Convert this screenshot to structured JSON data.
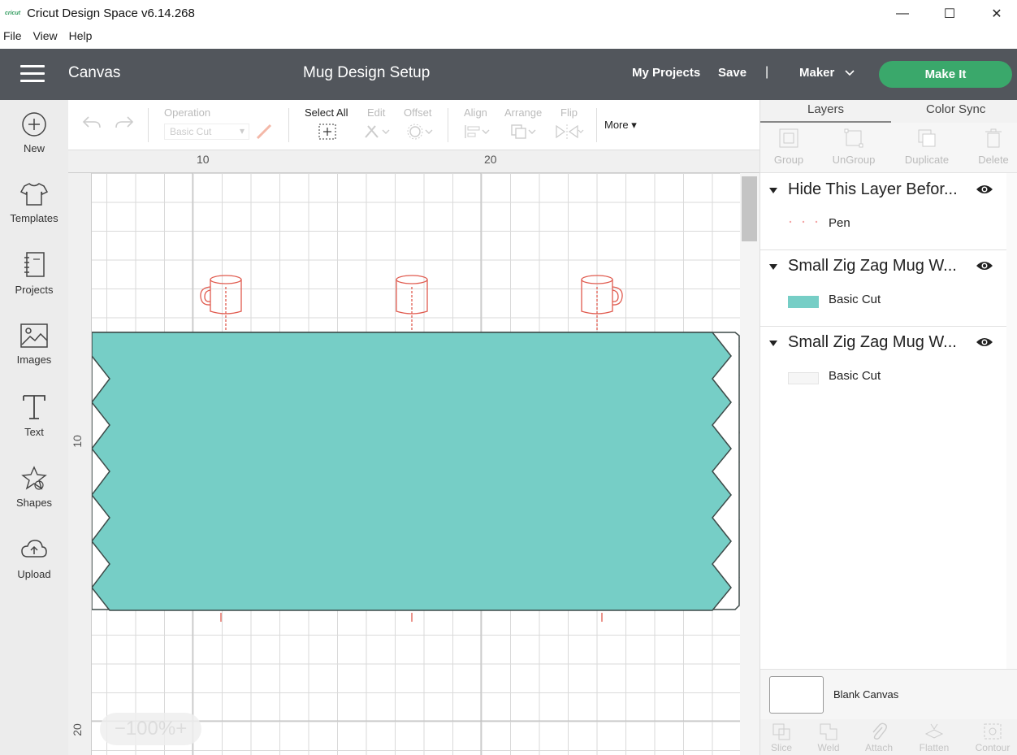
{
  "window": {
    "logo_text": "cricut",
    "title": "Cricut Design Space  v6.14.268",
    "minimize_glyph": "—",
    "maximize_glyph": "☐",
    "close_glyph": "✕"
  },
  "menu": [
    "File",
    "View",
    "Help"
  ],
  "header": {
    "section": "Canvas",
    "project_name": "Mug Design Setup",
    "my_projects": "My Projects",
    "save": "Save",
    "separator": "|",
    "machine": "Maker",
    "make_it": "Make It",
    "accent_color": "#3aa86b"
  },
  "sidebar": [
    {
      "label": "New",
      "icon": "plus-circle-icon"
    },
    {
      "label": "Templates",
      "icon": "tshirt-icon"
    },
    {
      "label": "Projects",
      "icon": "notebook-icon"
    },
    {
      "label": "Images",
      "icon": "image-icon"
    },
    {
      "label": "Text",
      "icon": "text-t-icon"
    },
    {
      "label": "Shapes",
      "icon": "shapes-icon"
    },
    {
      "label": "Upload",
      "icon": "cloud-upload-icon"
    }
  ],
  "toolbar": {
    "operation_label": "Operation",
    "operation_value": "Basic Cut",
    "select_all": "Select All",
    "edit": "Edit",
    "offset": "Offset",
    "align": "Align",
    "arrange": "Arrange",
    "flip": "Flip",
    "more": "More"
  },
  "rulers": {
    "top": [
      "10",
      "20"
    ],
    "left": [
      "10",
      "20"
    ]
  },
  "zoom": {
    "minus": "−",
    "value": "100%",
    "plus": "+"
  },
  "right_panel": {
    "tabs": [
      "Layers",
      "Color Sync"
    ],
    "actions": [
      "Group",
      "UnGroup",
      "Duplicate",
      "Delete"
    ],
    "layers": [
      {
        "title": "Hide This Layer Befor...",
        "item_label": "Pen",
        "swatch": "pen-dots",
        "color": "#f4a5a5"
      },
      {
        "title": "Small Zig Zag Mug W...",
        "item_label": "Basic Cut",
        "swatch": "solid",
        "color": "#76cec6"
      },
      {
        "title": "Small Zig Zag Mug W...",
        "item_label": "Basic Cut",
        "swatch": "solid",
        "color": "#f6f6f6"
      }
    ],
    "blank_canvas": "Blank Canvas",
    "bottom_actions": [
      "Slice",
      "Weld",
      "Attach",
      "Flatten",
      "Contour"
    ]
  },
  "design": {
    "mug_color": "#e05a4e",
    "fill_color": "#76cec6",
    "stroke_color": "#3d4a48"
  }
}
